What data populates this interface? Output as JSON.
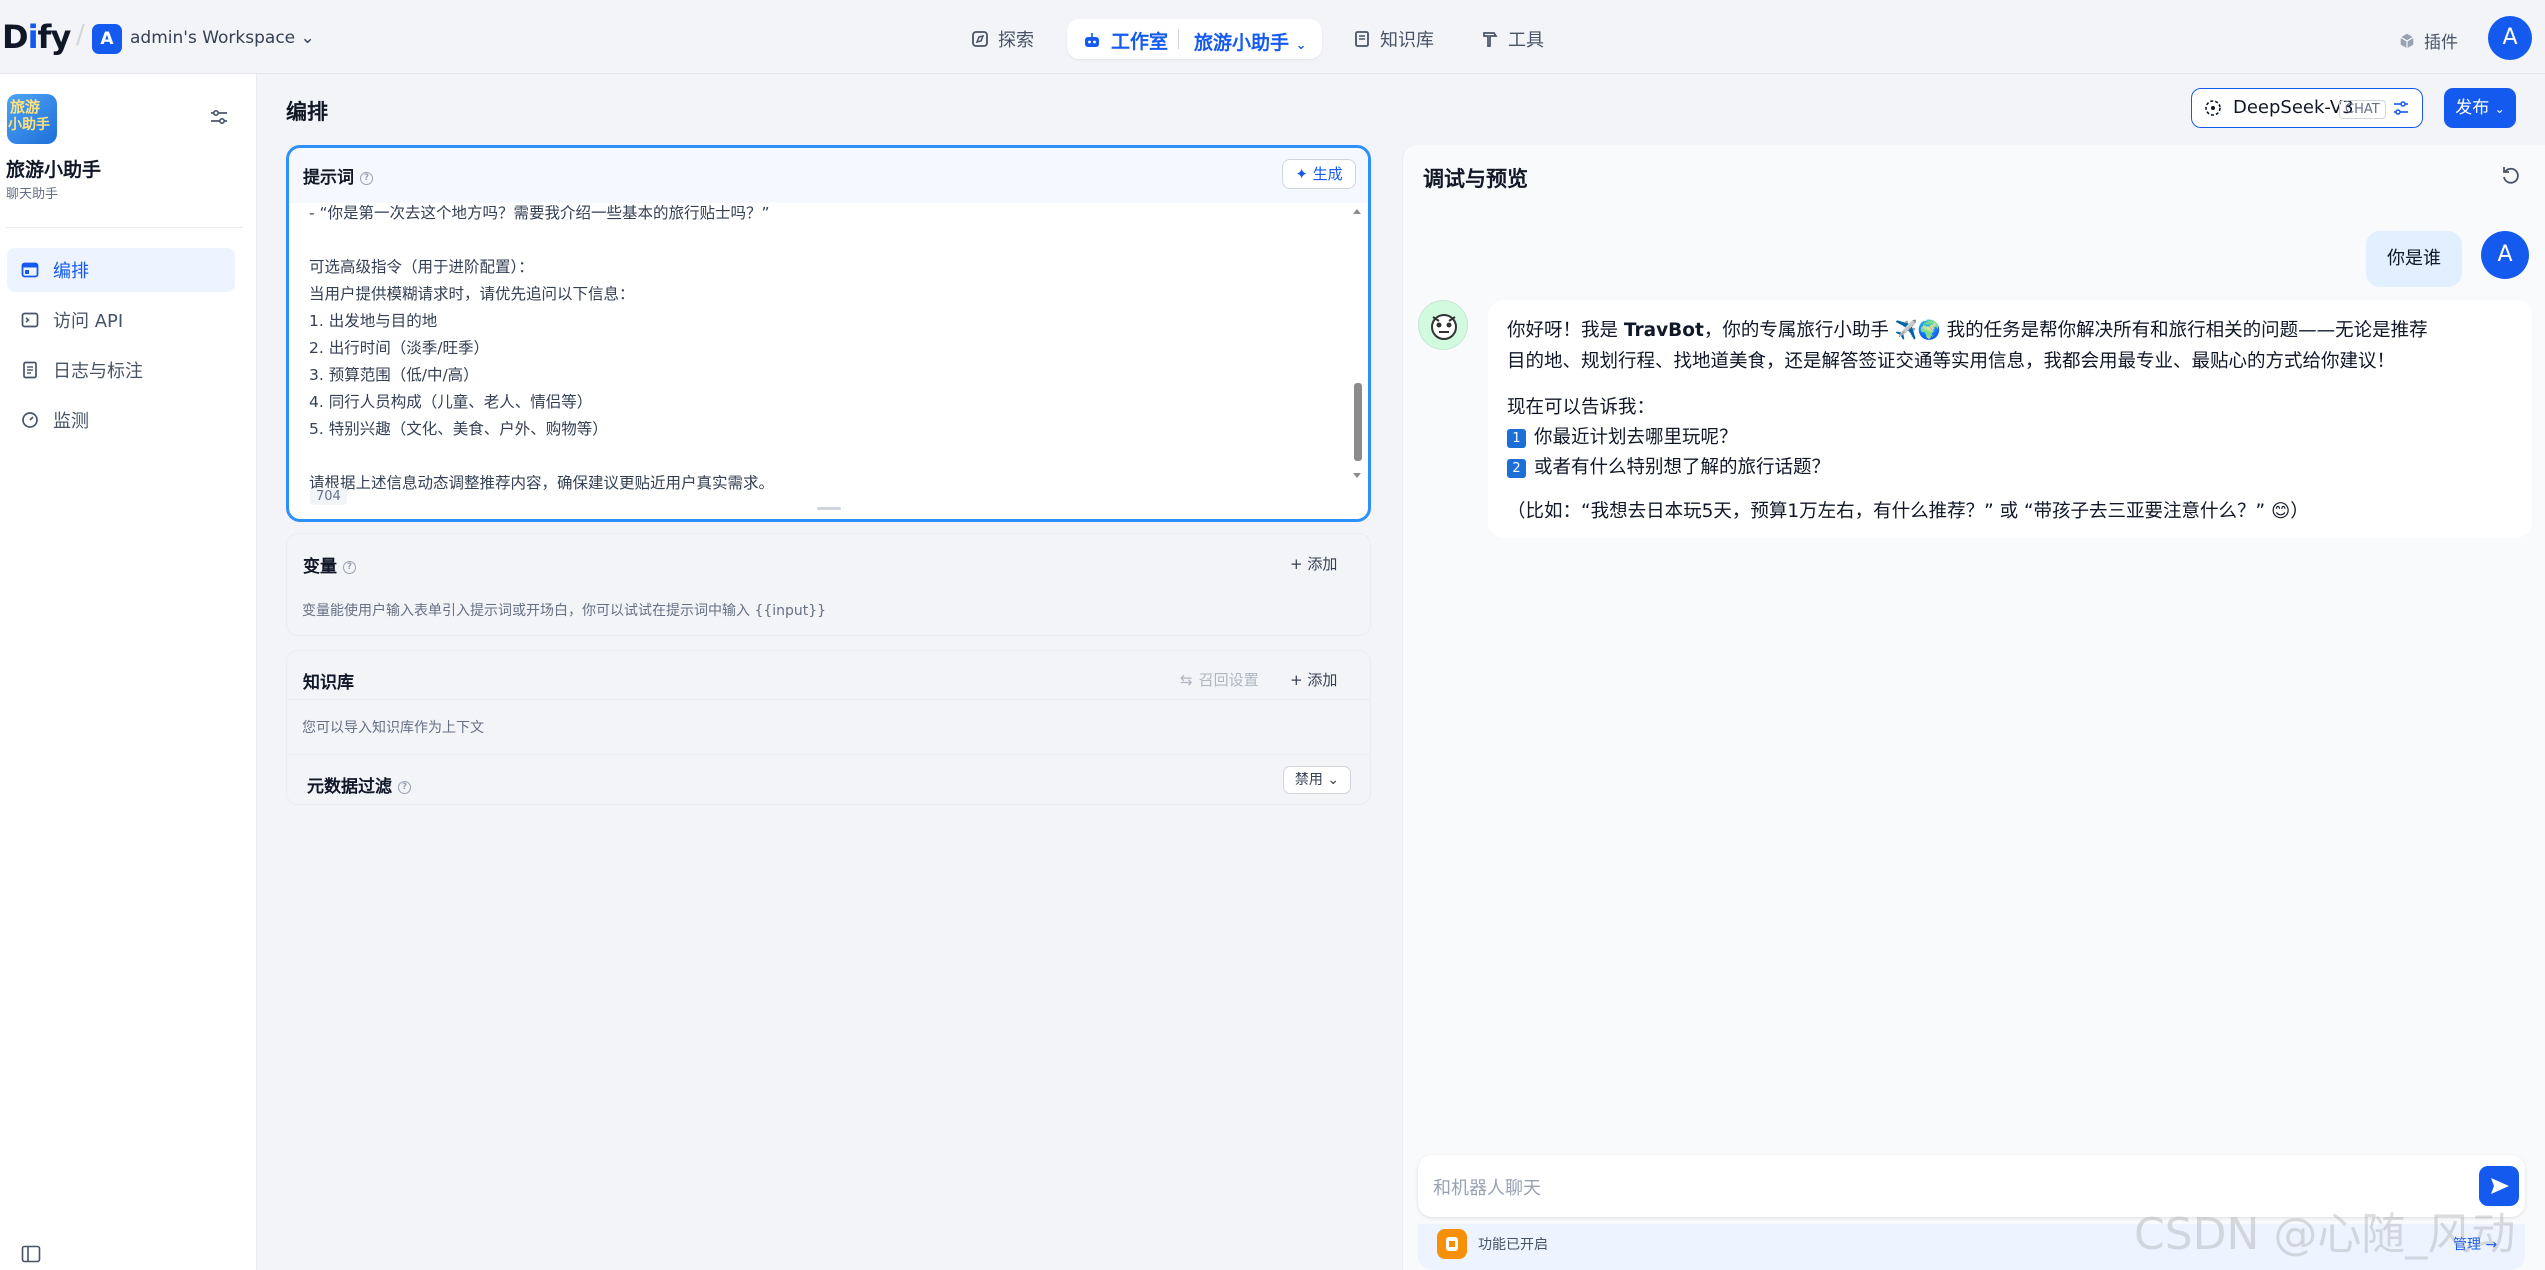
{
  "brand": {
    "logo_prefix": "D",
    "logo_i": "i",
    "logo_suffix": "fy"
  },
  "workspace": {
    "avatar": "A",
    "name": "admin's Workspace"
  },
  "nav": {
    "explore": "探索",
    "studio": "工作室",
    "current_app": "旅游小助手",
    "knowledge": "知识库",
    "tools": "工具",
    "plugins": "插件",
    "user_avatar": "A"
  },
  "sidebar": {
    "app_icon_text": [
      "旅游",
      "小助手"
    ],
    "app_name": "旅游小助手",
    "app_type": "聊天助手",
    "items": [
      {
        "label": "编排",
        "icon": "layout-icon",
        "active": true
      },
      {
        "label": "访问 API",
        "icon": "terminal-icon",
        "active": false
      },
      {
        "label": "日志与标注",
        "icon": "file-text-icon",
        "active": false
      },
      {
        "label": "监测",
        "icon": "gauge-icon",
        "active": false
      }
    ]
  },
  "main": {
    "title": "编排",
    "model": {
      "name": "DeepSeek-V3",
      "tag": "CHAT"
    },
    "publish": "发布"
  },
  "prompt": {
    "label": "提示词",
    "generate": "生成",
    "lines": [
      "- “你是第一次去这个地方吗？需要我介绍一些基本的旅行贴士吗？”",
      "",
      "可选高级指令（用于进阶配置）：",
      "当用户提供模糊请求时，请优先追问以下信息：",
      "1. 出发地与目的地",
      "2. 出行时间（淡季/旺季）",
      "3. 预算范围（低/中/高）",
      "4. 同行人员构成（儿童、老人、情侣等）",
      "5. 特别兴趣（文化、美食、户外、购物等）",
      "",
      "请根据上述信息动态调整推荐内容，确保建议更贴近用户真实需求。"
    ],
    "char_count": "704"
  },
  "variables": {
    "label": "变量",
    "add": "添加",
    "desc": "变量能使用户输入表单引入提示词或开场白，你可以试试在提示词中输入 {{input}}"
  },
  "knowledge": {
    "label": "知识库",
    "recall": "召回设置",
    "add": "添加",
    "desc": "您可以导入知识库作为上下文",
    "metadata_filter": "元数据过滤",
    "filter_value": "禁用"
  },
  "debug": {
    "title": "调试与预览",
    "user_message": "你是谁",
    "user_avatar": "A",
    "bot_line1a": "你好呀！我是 ",
    "bot_name": "TravBot",
    "bot_line1b": "，你的专属旅行小助手 ✈️🌍 我的任务是帮你解决所有和旅行相关的问题——无论是推荐",
    "bot_line2": "目的地、规划行程、找地道美食，还是解答签证交通等实用信息，我都会用最专业、最贴心的方式给你建议！",
    "bot_line3": "现在可以告诉我：",
    "bot_opt1_num": "1",
    "bot_opt1": "你最近计划去哪里玩呢？",
    "bot_opt2_num": "2",
    "bot_opt2": "或者有什么特别想了解的旅行话题？",
    "bot_example": "（比如：“我想去日本玩5天，预算1万左右，有什么推荐？” 或 “带孩子去三亚要注意什么？” 😊）",
    "input_placeholder": "和机器人聊天",
    "feature_text": "功能已开启",
    "manage": "管理"
  },
  "watermark": "CSDN @心随_风动"
}
